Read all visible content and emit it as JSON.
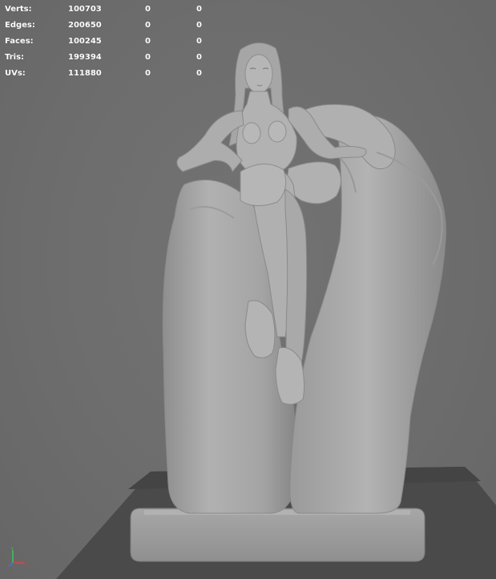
{
  "poly_count": {
    "rows": [
      {
        "label": "Verts:",
        "value": "100703",
        "selected": "0",
        "component": "0"
      },
      {
        "label": "Edges:",
        "value": "200650",
        "selected": "0",
        "component": "0"
      },
      {
        "label": "Faces:",
        "value": "100245",
        "selected": "0",
        "component": "0"
      },
      {
        "label": "Tris:",
        "value": "199394",
        "selected": "0",
        "component": "0"
      },
      {
        "label": "UVs:",
        "value": "111880",
        "selected": "0",
        "component": "0"
      }
    ]
  },
  "viewport": {
    "background": "#6d6d6d",
    "model_color": "#a9a9a9",
    "ground_color": "#4a4a4a"
  },
  "axis_gizmo": {
    "icon": "axis-gizmo-icon",
    "x_color": "#e04040",
    "y_color": "#40c060",
    "z_color": "#4070e0"
  }
}
